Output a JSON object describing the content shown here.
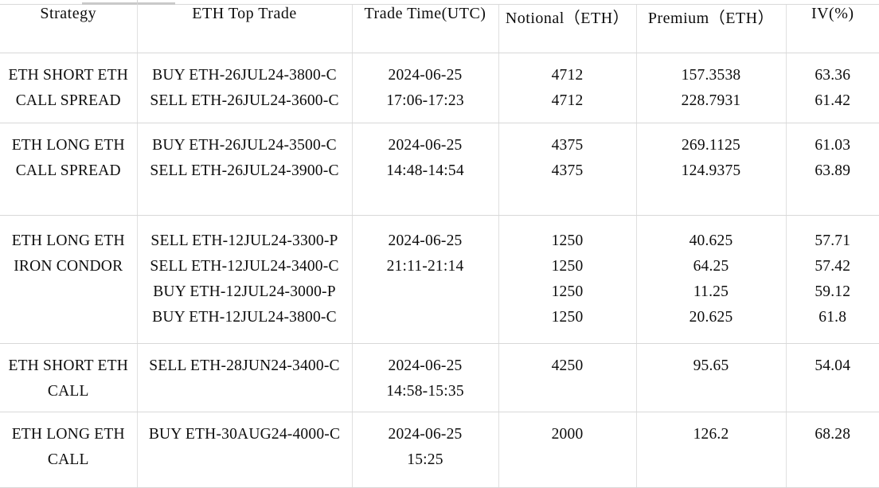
{
  "table": {
    "columns": [
      {
        "key": "strategy",
        "label": "Strategy"
      },
      {
        "key": "top_trade",
        "label": "ETH Top Trade"
      },
      {
        "key": "trade_time",
        "label": "Trade Time(UTC)"
      },
      {
        "key": "notional",
        "label": "Notional（ETH）"
      },
      {
        "key": "premium",
        "label": "Premium（ETH）"
      },
      {
        "key": "iv",
        "label": "IV(%)"
      }
    ],
    "rows": [
      {
        "strategy": [
          "ETH SHORT ETH",
          "CALL SPREAD"
        ],
        "top_trade": [
          "BUY ETH-26JUL24-3800-C",
          "SELL ETH-26JUL24-3600-C"
        ],
        "trade_time": [
          "2024-06-25",
          "17:06-17:23"
        ],
        "notional": [
          "4712",
          "4712"
        ],
        "premium": [
          "157.3538",
          "228.7931"
        ],
        "iv": [
          "63.36",
          "61.42"
        ]
      },
      {
        "strategy": [
          "ETH LONG ETH",
          "CALL SPREAD"
        ],
        "top_trade": [
          "BUY ETH-26JUL24-3500-C",
          "SELL ETH-26JUL24-3900-C"
        ],
        "trade_time": [
          "2024-06-25",
          "14:48-14:54"
        ],
        "notional": [
          "4375",
          "4375"
        ],
        "premium": [
          "269.1125",
          "124.9375"
        ],
        "iv": [
          "61.03",
          "63.89"
        ]
      },
      {
        "strategy": [
          "ETH LONG ETH",
          "IRON CONDOR"
        ],
        "top_trade": [
          "SELL ETH-12JUL24-3300-P",
          "SELL ETH-12JUL24-3400-C",
          "BUY ETH-12JUL24-3000-P",
          "BUY ETH-12JUL24-3800-C"
        ],
        "trade_time": [
          "2024-06-25",
          "21:11-21:14"
        ],
        "notional": [
          "1250",
          "1250",
          "1250",
          "1250"
        ],
        "premium": [
          "40.625",
          "64.25",
          "11.25",
          "20.625"
        ],
        "iv": [
          "57.71",
          "57.42",
          "59.12",
          "61.8"
        ]
      },
      {
        "strategy": [
          "ETH SHORT ETH",
          "CALL"
        ],
        "top_trade": [
          "SELL ETH-28JUN24-3400-C"
        ],
        "trade_time": [
          "2024-06-25",
          "14:58-15:35"
        ],
        "notional": [
          "4250"
        ],
        "premium": [
          "95.65"
        ],
        "iv": [
          "54.04"
        ]
      },
      {
        "strategy": [
          "ETH LONG ETH",
          "CALL"
        ],
        "top_trade": [
          "BUY ETH-30AUG24-4000-C"
        ],
        "trade_time": [
          "2024-06-25",
          "15:25"
        ],
        "notional": [
          "2000"
        ],
        "premium": [
          "126.2"
        ],
        "iv": [
          "68.28"
        ]
      }
    ]
  },
  "colors": {
    "background": "#ffffff",
    "text": "#0d0d0d",
    "grid": "#dcdcdc"
  }
}
